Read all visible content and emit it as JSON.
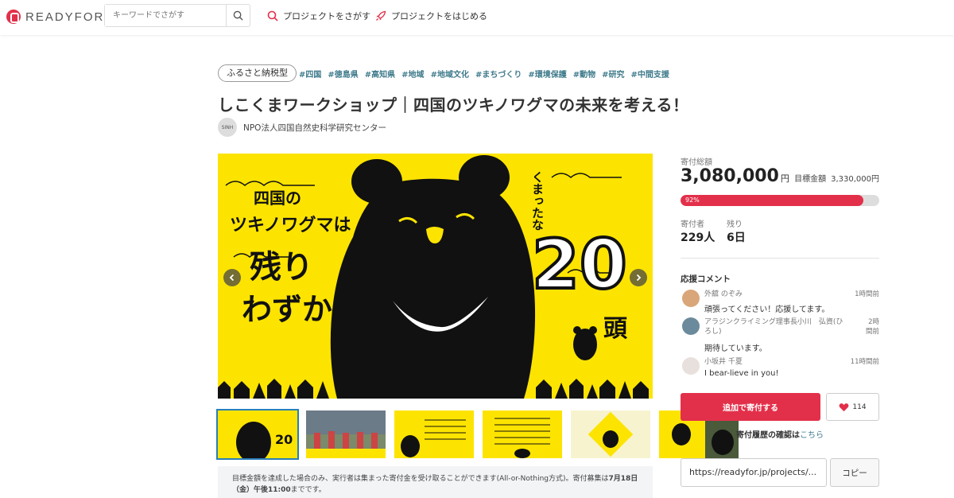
{
  "header": {
    "logo_text": "READYFOR",
    "search_placeholder": "キーワードでさがす",
    "nav": [
      {
        "label": "プロジェクトをさがす",
        "icon": "search-icon"
      },
      {
        "label": "プロジェクトをはじめる",
        "icon": "rocket-icon"
      }
    ]
  },
  "project": {
    "type_tag": "ふるさと納税型",
    "hashtags": [
      "#四国",
      "#徳島県",
      "#高知県",
      "#地域",
      "#地域文化",
      "#まちづくり",
      "#環境保護",
      "#動物",
      "#研究",
      "#中間支援"
    ],
    "title": "しこくまワークショップ｜四国のツキノワグマの未来を考える！",
    "org_name": "NPO法人四国自然史科学研究センター",
    "org_avatar_text": "SINH"
  },
  "hero": {
    "line1": "四国の",
    "line2": "ツキノワグマは",
    "line3": "残り",
    "line4": "わずか",
    "side_text": "くまったな",
    "big_number": "20",
    "unit": "頭"
  },
  "notice": {
    "text_prefix": "目標金額を達成した場合のみ、実行者は集まった寄付金を受け取ることができます(All-or-Nothing方式)。寄付募集は",
    "deadline": "7月18日（金）午後11:00",
    "text_suffix": "までです。"
  },
  "stats": {
    "total_label": "寄付総額",
    "total_amount": "3,080,000",
    "total_unit": "円",
    "goal_label": "目標金額",
    "goal_amount": "3,330,000円",
    "progress_percent": 92,
    "progress_label": "92%",
    "supporters_label": "寄付者",
    "supporters_value": "229人",
    "remaining_label": "残り",
    "remaining_value": "6日"
  },
  "comments": {
    "heading": "応援コメント",
    "items": [
      {
        "name": "外舘 のぞみ",
        "time": "1時間前",
        "text": "頑張ってください！応援してます。"
      },
      {
        "name": "アラジンクライミング理事長小川　弘資(ひろし)",
        "time": "2時間前",
        "text": "期待しています。"
      },
      {
        "name": "小坂井 千夏",
        "time": "11時間前",
        "text": "I bear-lieve in you!"
      }
    ]
  },
  "actions": {
    "donate_label": "追加で寄付する",
    "favorite_count": "114",
    "history_label": "寄付履歴の確認は",
    "history_link": "こちら",
    "share_url": "https://readyfor.jp/projects/...",
    "copy_label": "コピー"
  }
}
